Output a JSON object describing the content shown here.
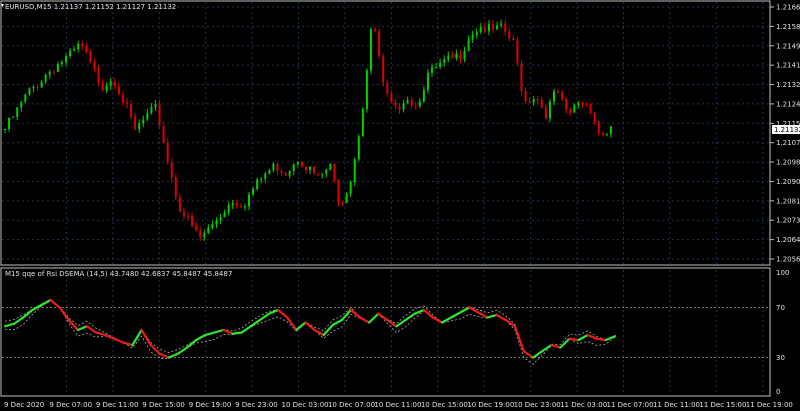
{
  "main_chart": {
    "title": "EURUSD,M15  1.21137 1.21152 1.21127 1.21132",
    "price_labels": [
      "1.21665",
      "1.21580",
      "1.21495",
      "1.21410",
      "1.21325",
      "1.21240",
      "1.21155",
      "1.21070",
      "1.20985",
      "1.20900",
      "1.20815",
      "1.20730",
      "1.20645",
      "1.20560"
    ],
    "current_price": "1.21132",
    "colors": {
      "bull": "#00d000",
      "bear": "#e00000",
      "grid": "#1f3450",
      "axis": "#bfbfbf",
      "price_tag_bg": "#ffffff"
    }
  },
  "indicator": {
    "title": "M15 qqe of Rsi DSEMA (14,5) 43.7480 42.6837 45.8487 45.8487",
    "scale_labels": [
      "100",
      "70",
      "30",
      "0"
    ],
    "colors": {
      "up": "#2ee62e",
      "down": "#ee1a1a",
      "signal": "#b0b0b0",
      "level": "#9a9a9a"
    }
  },
  "time_axis": {
    "labels": [
      "9 Dec 2020",
      "9 Dec 07:00",
      "9 Dec 11:00",
      "9 Dec 15:00",
      "9 Dec 19:00",
      "9 Dec 23:00",
      "10 Dec 03:00",
      "10 Dec 07:00",
      "10 Dec 11:00",
      "10 Dec 15:00",
      "10 Dec 19:00",
      "10 Dec 23:00",
      "11 Dec 03:00",
      "11 Dec 07:00",
      "11 Dec 11:00",
      "11 Dec 15:00",
      "11 Dec 19:00"
    ]
  },
  "chart_data": {
    "type": "candlestick",
    "symbol": "EURUSD",
    "timeframe": "M15",
    "ohlc_last": {
      "open": 1.21137,
      "high": 1.21152,
      "low": 1.21127,
      "close": 1.21132
    },
    "ylim": [
      1.2056,
      1.21665
    ],
    "close_path": [
      1.2113,
      1.212,
      1.2128,
      1.2133,
      1.2138,
      1.2142,
      1.2145,
      1.215,
      1.214,
      1.2132,
      1.2136,
      1.2125,
      1.2112,
      1.2118,
      1.2122,
      1.21,
      1.208,
      1.2072,
      1.2065,
      1.207,
      1.2076,
      1.2082,
      1.208,
      1.2087,
      1.2093,
      1.2097,
      1.2094,
      1.2101,
      1.2096,
      1.2091,
      1.2097,
      1.208,
      1.2092,
      1.212,
      1.2162,
      1.213,
      1.212,
      1.2128,
      1.2123,
      1.2136,
      1.214,
      1.2143,
      1.2145,
      1.2155,
      1.2158,
      1.2156,
      1.2157,
      1.215,
      1.2125,
      1.2128,
      1.212,
      1.213,
      1.2118,
      1.2125,
      1.2124,
      1.211,
      1.2113
    ],
    "indicator": {
      "name": "qqe of Rsi DSEMA (14,5)",
      "values": [
        43.748,
        42.6837,
        45.8487,
        45.8487
      ],
      "levels": [
        30,
        70
      ],
      "ylim": [
        0,
        100
      ],
      "line_path": [
        55,
        57,
        62,
        68,
        72,
        76,
        70,
        60,
        52,
        55,
        50,
        48,
        45,
        42,
        40,
        52,
        40,
        33,
        30,
        33,
        38,
        44,
        48,
        50,
        52,
        49,
        50,
        55,
        60,
        65,
        68,
        62,
        52,
        58,
        52,
        48,
        56,
        60,
        68,
        62,
        58,
        65,
        60,
        55,
        60,
        65,
        68,
        62,
        58,
        62,
        66,
        70,
        66,
        62,
        64,
        60,
        55,
        35,
        30,
        35,
        40,
        38,
        45,
        44,
        48,
        45,
        44,
        47
      ]
    }
  }
}
